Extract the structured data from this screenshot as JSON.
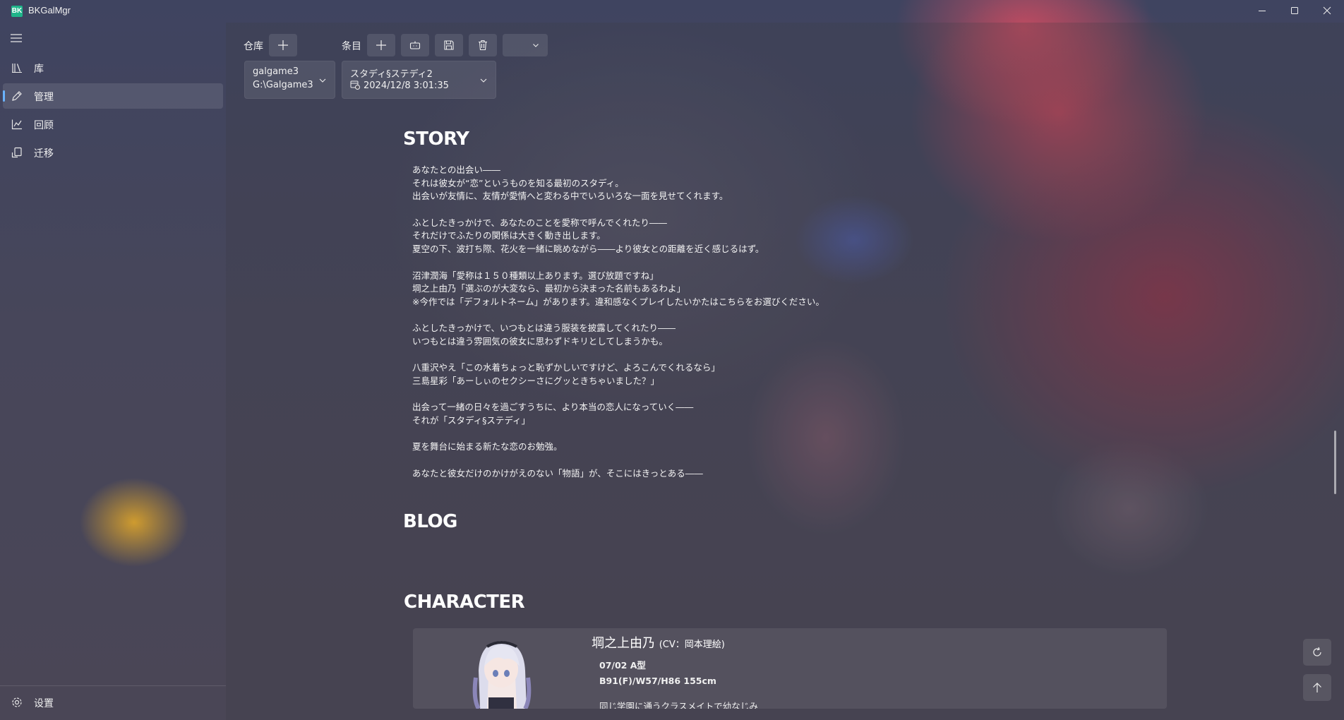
{
  "window": {
    "app_icon_text": "BK",
    "title": "BKGalMgr"
  },
  "sidebar": {
    "items": [
      {
        "label": "库",
        "icon": "library-icon"
      },
      {
        "label": "管理",
        "icon": "edit-icon"
      },
      {
        "label": "回顾",
        "icon": "chart-icon"
      },
      {
        "label": "迁移",
        "icon": "migrate-icon"
      }
    ],
    "selected": "管理",
    "settings_label": "设置"
  },
  "toolbar": {
    "repo_label": "仓库",
    "entry_label": "条目",
    "dropdown_value": ""
  },
  "repo_combo": {
    "name": "galgame3",
    "path": "G:\\Galgame3"
  },
  "entry_combo": {
    "name": "スタディ§ステディ2",
    "date": "2024/12/8 3:01:35"
  },
  "sections": {
    "story": "STORY",
    "blog": "BLOG",
    "character": "CHARACTER"
  },
  "story_lines": [
    "あなたとの出会い――",
    "それは彼女が“恋”というものを知る最初のスタディ。",
    "出会いが友情に、友情が愛情へと変わる中でいろいろな一面を見せてくれます。",
    "",
    "ふとしたきっかけで、あなたのことを愛称で呼んでくれたり――",
    "それだけでふたりの関係は大きく動き出します。",
    "夏空の下、波打ち際、花火を一緒に眺めながら――より彼女との距離を近く感じるはず。",
    "",
    "沼津潤海「愛称は１５０種類以上あります。選び放題ですね」",
    "堈之上由乃「選ぶのが大変なら、最初から決まった名前もあるわよ」",
    "※今作では「デフォルトネーム」があります。違和感なくプレイしたいかたはこちらをお選びください。",
    "",
    "ふとしたきっかけで、いつもとは違う服装を披露してくれたり――",
    "いつもとは違う雰囲気の彼女に思わずドキリとしてしまうかも。",
    "",
    "八重沢やえ「この水着ちょっと恥ずかしいですけど、よろこんでくれるなら」",
    "三島星彩「あーしぃのセクシーさにグッときちゃいました？」",
    "",
    "出会って一緒の日々を過ごすうちに、より本当の恋人になっていく――",
    "それが「スタディ§ステディ」",
    "",
    "夏を舞台に始まる新たな恋のお勉強。",
    "",
    "あなたと彼女だけのかけがえのない「物語」が、そこにはきっとある――"
  ],
  "character": {
    "name": "堈之上由乃",
    "cv": "(CV：岡本理絵)",
    "birthday_blood": "07/02  A型",
    "measurements": "B91(F)/W57/H86  155cm",
    "desc": "同じ学園に通うクラスメイトで幼なじみ"
  },
  "colors": {
    "accent": "#6ab3ff",
    "app_icon": "#1fb58a"
  }
}
